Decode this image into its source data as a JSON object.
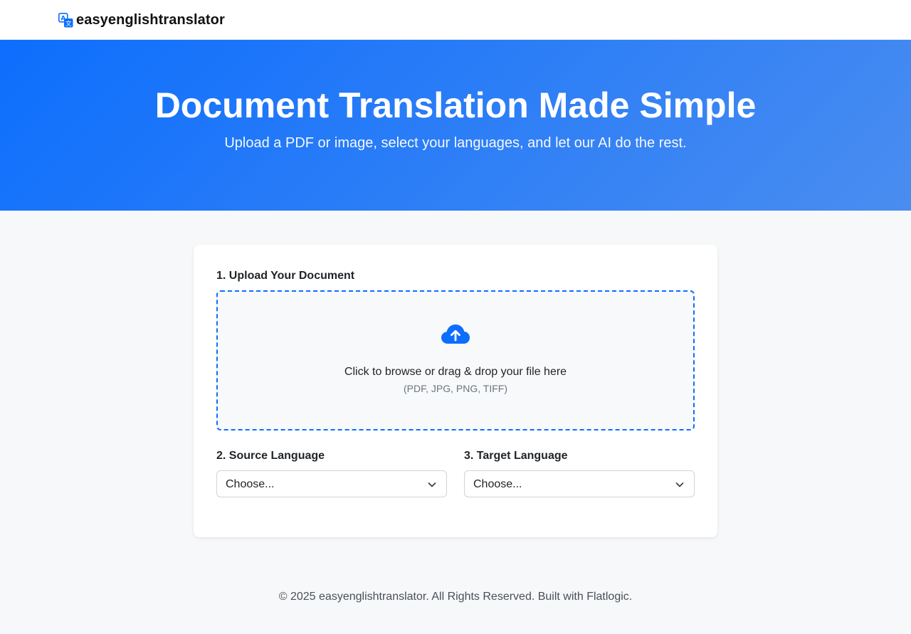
{
  "app": {
    "name": "easyenglishtranslator"
  },
  "hero": {
    "title": "Document Translation Made Simple",
    "subtitle": "Upload a PDF or image, select your languages, and let our AI do the rest."
  },
  "form": {
    "upload_label": "1. Upload Your Document",
    "dropzone_text": "Click to browse or drag & drop your file here",
    "dropzone_formats": "(PDF, JPG, PNG, TIFF)",
    "source_label": "2. Source Language",
    "source_value": "Choose...",
    "target_label": "3. Target Language",
    "target_value": "Choose..."
  },
  "footer": {
    "text": "© 2025 easyenglishtranslator. All Rights Reserved. Built with Flatlogic."
  },
  "icons": {
    "brand": "translate-icon",
    "upload": "cloud-upload-icon",
    "select": "chevron-down-icon"
  },
  "colors": {
    "primary": "#0d6efd",
    "hero_gradient_end": "#4a8df0",
    "page_background": "#f7f8fa"
  }
}
